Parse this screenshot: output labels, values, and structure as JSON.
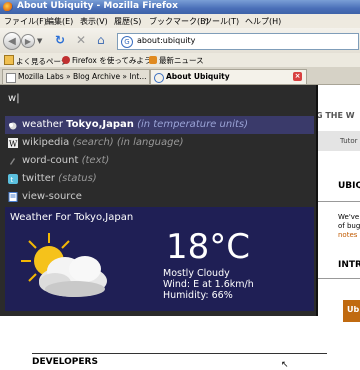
{
  "window": {
    "title": "About Ubiquity - Mozilla Firefox"
  },
  "menubar": [
    "ファイル(F)",
    "編集(E)",
    "表示(V)",
    "履歴(S)",
    "ブックマーク(B)",
    "ツール(T)",
    "ヘルプ(H)"
  ],
  "navbar": {
    "url": "about:ubiquity"
  },
  "bookmarks": [
    "よく見るページ",
    "Firefox を使ってみよう",
    "最新ニュース"
  ],
  "tabs": [
    {
      "label": "Mozilla Labs » Blog Archive » Int..."
    },
    {
      "label": "About Ubiquity"
    }
  ],
  "page": {
    "banner": "G THE W",
    "band_text": "Tutor",
    "heading1": "UBIQ",
    "sidetext": [
      "We've",
      "of bug",
      "notes"
    ],
    "heading2": "INTR",
    "button_text": "Ub",
    "footer_heading": "DEVELOPERS"
  },
  "ubiquity": {
    "input": "w",
    "suggestions": [
      {
        "cmd": "weather",
        "bold": "Tokyo,Japan",
        "arg": "(in temperature units)",
        "icon": "weather-icon",
        "selected": true
      },
      {
        "cmd": "wikipedia",
        "bold": "",
        "arg": "(search) (in language)",
        "icon": "wikipedia-icon",
        "selected": false
      },
      {
        "cmd": "word-count",
        "bold": "",
        "arg": "(text)",
        "icon": "word-count-icon",
        "selected": false
      },
      {
        "cmd": "twitter",
        "bold": "",
        "arg": "(status)",
        "icon": "twitter-icon",
        "selected": false
      },
      {
        "cmd": "view-source",
        "bold": "",
        "arg": "",
        "icon": "view-source-icon",
        "selected": false
      }
    ],
    "preview": {
      "title": "Weather For Tokyo,Japan",
      "temperature": "18°C",
      "condition": "Mostly Cloudy",
      "wind": "Wind: E at 1.6km/h",
      "humidity": "Humidity: 66%"
    }
  }
}
